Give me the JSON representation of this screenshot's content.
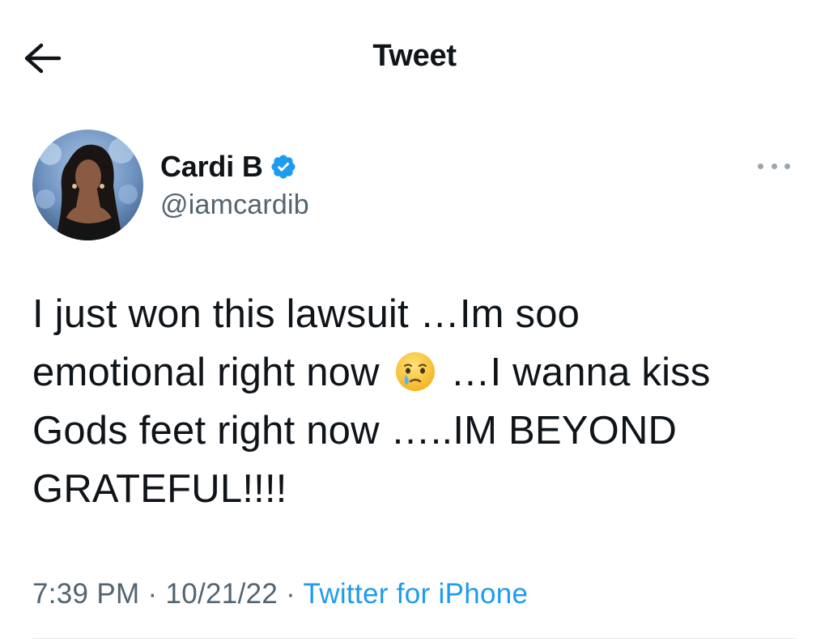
{
  "header": {
    "title": "Tweet",
    "back_icon": "arrow-left-icon"
  },
  "author": {
    "display_name": "Cardi B",
    "handle": "@iamcardib",
    "verified_icon": "verified-badge-icon",
    "verified_color": "#1d9bf0",
    "more_icon": "more-horizontal-icon"
  },
  "tweet": {
    "line1": "I just won this lawsuit …Im soo",
    "line2_before_emoji": "emotional right now",
    "emoji": "face-holding-back-tears-emoji",
    "line2_after_emoji": "…I wanna kiss",
    "line3": "Gods feet right now …..IM BEYOND",
    "line4": "GRATEFUL!!!!"
  },
  "meta": {
    "time": "7:39 PM",
    "sep1": "·",
    "date": "10/21/22",
    "sep2": "·",
    "source": "Twitter for iPhone"
  },
  "colors": {
    "text": "#0f1419",
    "secondary": "#536471",
    "accent": "#1d9bf0"
  }
}
